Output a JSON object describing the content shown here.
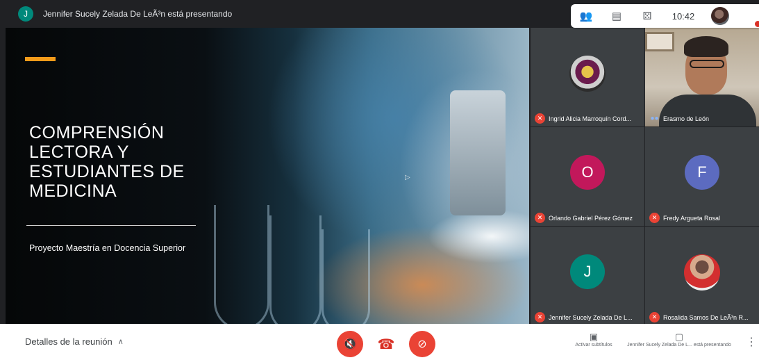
{
  "presenter": {
    "avatar_letter": "J",
    "banner_text": "Jennifer Sucely Zelada De LeÃ³n está presentando"
  },
  "topbar": {
    "icons": [
      "people-icon",
      "chat-icon",
      "activities-icon"
    ],
    "time": "10:42"
  },
  "slide": {
    "title": "COMPRENSIÓN LECTORA Y ESTUDIANTES DE MEDICINA",
    "subtitle": "Proyecto Maestría en Docencia Superior",
    "accent_color": "#f29b1a"
  },
  "participants": [
    {
      "name": "Ingrid Alicia Marroquín Cord...",
      "avatar": "photo",
      "muted": true
    },
    {
      "name": "Erasmo de León",
      "avatar": "video",
      "muted": false,
      "speaking": true
    },
    {
      "name": "Orlando Gabriel Pérez Gómez",
      "avatar": "letter",
      "letter": "O",
      "color": "#c2185b",
      "muted": true
    },
    {
      "name": "Fredy Argueta Rosal",
      "avatar": "letter",
      "letter": "F",
      "color": "#5c6bc0",
      "muted": true
    },
    {
      "name": "Jennifer Sucely Zelada De L...",
      "avatar": "letter",
      "letter": "J",
      "color": "#00897b",
      "muted": true
    },
    {
      "name": "Rosalida Samos De LeÃ³n R...",
      "avatar": "photo",
      "muted": true
    }
  ],
  "bottom": {
    "meeting_details": "Detalles de la reunión",
    "captions_label": "Activar subtítulos",
    "present_label": "Jennifer Sucely Zelada De L... está presentando"
  }
}
